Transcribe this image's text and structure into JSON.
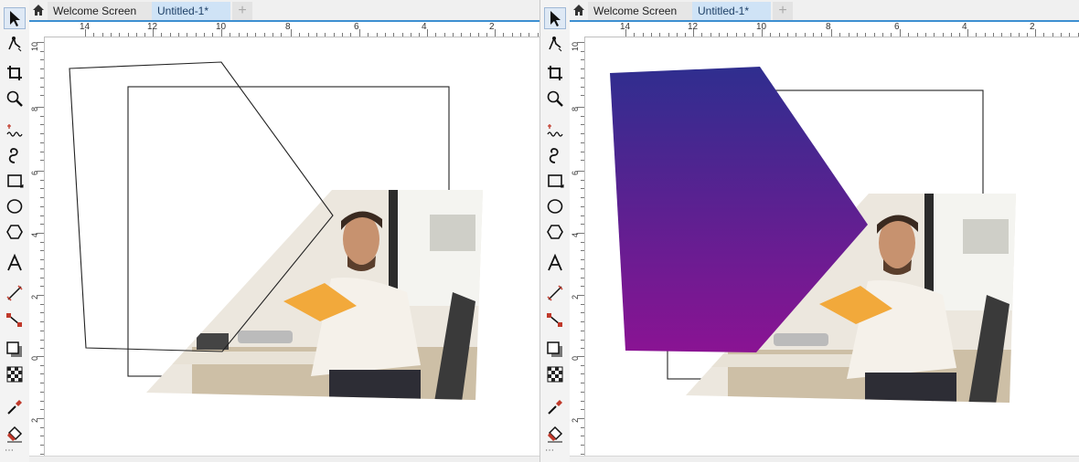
{
  "tabs": {
    "welcome": "Welcome Screen",
    "document": "Untitled-1*",
    "add": "+"
  },
  "ruler": {
    "top_labels": [
      "14",
      "12",
      "10",
      "8",
      "6",
      "4",
      "2"
    ],
    "left_labels": [
      "10",
      "8",
      "6",
      "4",
      "2",
      "0",
      "2"
    ]
  },
  "tools": [
    {
      "name": "pick-tool",
      "icon": "arrow-icon"
    },
    {
      "name": "shape-tool",
      "icon": "node-edit-icon"
    },
    {
      "name": "crop-tool",
      "icon": "crop-icon"
    },
    {
      "name": "zoom-tool",
      "icon": "magnifier-icon"
    },
    {
      "name": "freehand-tool",
      "icon": "freehand-icon"
    },
    {
      "name": "artistic-media-tool",
      "icon": "spiral-icon"
    },
    {
      "name": "rectangle-tool",
      "icon": "rectangle-icon"
    },
    {
      "name": "ellipse-tool",
      "icon": "ellipse-icon"
    },
    {
      "name": "polygon-tool",
      "icon": "hexagon-icon"
    },
    {
      "name": "text-tool",
      "icon": "text-a-icon"
    },
    {
      "name": "parallel-dimension-tool",
      "icon": "dimension-line-icon"
    },
    {
      "name": "connector-tool",
      "icon": "connector-icon"
    },
    {
      "name": "drop-shadow-tool",
      "icon": "shadow-icon"
    },
    {
      "name": "transparency-tool",
      "icon": "checker-icon"
    },
    {
      "name": "color-eyedropper-tool",
      "icon": "eyedropper-icon"
    },
    {
      "name": "interactive-fill-tool",
      "icon": "paint-bucket-icon"
    }
  ],
  "colors": {
    "gradient_top": "#2f2e8f",
    "gradient_bottom": "#8a1393",
    "tab_active_bg": "#cfe3f6",
    "tab_underline": "#3d8fd1"
  },
  "photo": {
    "description_icon": "photo-man-with-book-icon"
  }
}
